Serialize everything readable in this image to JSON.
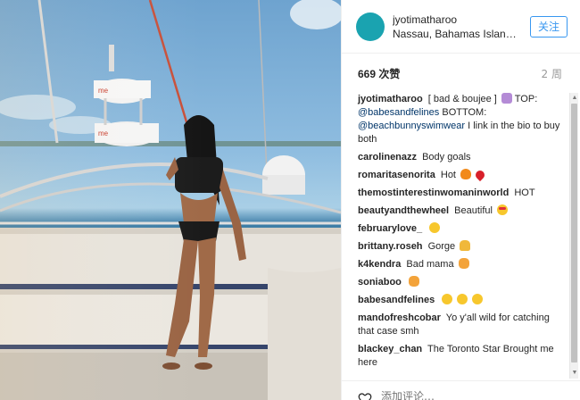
{
  "post": {
    "username": "jyotimatharoo",
    "location": "Nassau, Bahamas Islan…",
    "follow_label": "关注",
    "likes_count": "669",
    "likes_unit": "次赞",
    "time_ago": "2 周"
  },
  "caption": {
    "author": "jyotimatharoo",
    "text_1": "[ bad & boujee ]",
    "text_2": "TOP:",
    "mention_1": "@babesandfelines",
    "text_3": "BOTTOM:",
    "mention_2": "@beachbunnyswimwear",
    "text_4": "I link in the bio to buy both"
  },
  "comments": [
    {
      "author": "carolinenazz",
      "text": "Body goals"
    },
    {
      "author": "romaritasenorita",
      "text": "Hot"
    },
    {
      "author": "themostinterestinwomaninworld",
      "text": "HOT"
    },
    {
      "author": "beautyandthewheel",
      "text": "Beautiful"
    },
    {
      "author": "februarylove_",
      "text": ""
    },
    {
      "author": "brittany.roseh",
      "text": "Gorge"
    },
    {
      "author": "k4kendra",
      "text": "Bad mama"
    },
    {
      "author": "soniaboo",
      "text": ""
    },
    {
      "author": "babesandfelines",
      "text": ""
    },
    {
      "author": "mandofreshcobar",
      "text": "Yo y'all wild for catching that case smh"
    },
    {
      "author": "blackey_chan",
      "text": "The Toronto Star Brought me here"
    }
  ],
  "footer": {
    "comment_placeholder": "添加评论…"
  },
  "colors": {
    "avatar": "#1aa3b0",
    "follow_blue": "#3897f0",
    "mention": "#003569"
  },
  "icons": {
    "like": "heart-outline-icon"
  }
}
